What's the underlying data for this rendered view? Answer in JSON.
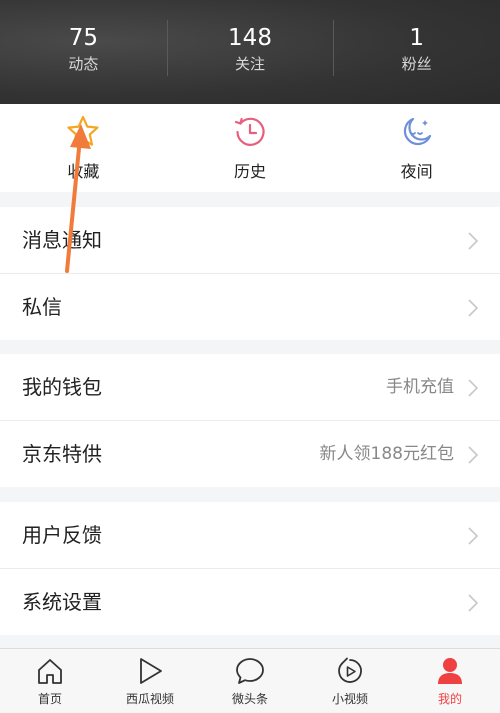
{
  "stats": [
    {
      "value": "75",
      "label": "动态"
    },
    {
      "value": "148",
      "label": "关注"
    },
    {
      "value": "1",
      "label": "粉丝"
    }
  ],
  "quick": [
    {
      "label": "收藏",
      "icon": "star-icon"
    },
    {
      "label": "历史",
      "icon": "history-clock-icon"
    },
    {
      "label": "夜间",
      "icon": "moon-icon"
    }
  ],
  "groups": [
    {
      "rows": [
        {
          "title": "消息通知",
          "extra": ""
        },
        {
          "title": "私信",
          "extra": ""
        }
      ]
    },
    {
      "rows": [
        {
          "title": "我的钱包",
          "extra": "手机充值"
        },
        {
          "title": "京东特供",
          "extra": "新人领188元红包"
        }
      ]
    },
    {
      "rows": [
        {
          "title": "用户反馈",
          "extra": ""
        },
        {
          "title": "系统设置",
          "extra": ""
        }
      ]
    }
  ],
  "tabs": [
    {
      "label": "首页",
      "icon": "home-icon"
    },
    {
      "label": "西瓜视频",
      "icon": "play-icon"
    },
    {
      "label": "微头条",
      "icon": "speech-bubble-icon"
    },
    {
      "label": "小视频",
      "icon": "short-video-icon"
    },
    {
      "label": "我的",
      "icon": "person-icon"
    }
  ],
  "colors": {
    "accent": "#f04142",
    "star": "#f5a623",
    "history": "#e75f7c",
    "moon": "#6f8fd8",
    "arrow": "#f07b3a"
  }
}
